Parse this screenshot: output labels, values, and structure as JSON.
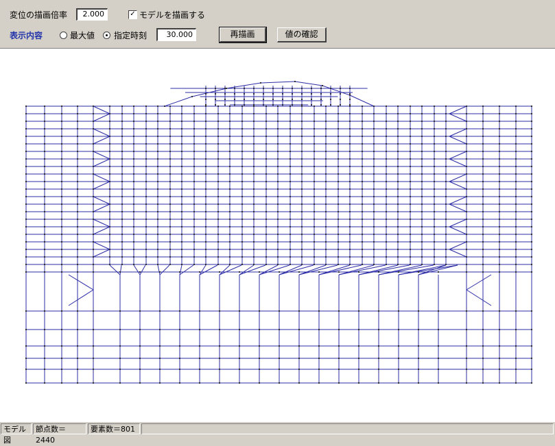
{
  "toolbar": {
    "scale_label": "変位の描画倍率",
    "scale_value": "2.000",
    "draw_model_label": "モデルを描画する",
    "draw_model_checked": true,
    "display_label": "表示内容",
    "radio_max_label": "最大値",
    "radio_time_label": "指定時刻",
    "selected_mode": "指定時刻",
    "time_value": "30.000",
    "redraw_label": "再描画",
    "confirm_label": "値の確認"
  },
  "status": {
    "view": "モデル図",
    "nodes": "節点数＝2440",
    "elements": "要素数＝801"
  },
  "colors": {
    "mesh_line": "#2b2ba6",
    "node_dot": "#333333",
    "background": "#d4d0c8"
  }
}
